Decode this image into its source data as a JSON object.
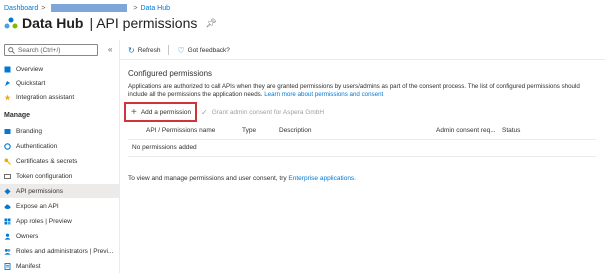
{
  "breadcrumb": {
    "dashboard": "Dashboard",
    "separator": ">",
    "current": "Data Hub"
  },
  "header": {
    "app_title": "Data Hub",
    "page_title": "| API permissions",
    "pin_icon": "pin-icon"
  },
  "sidebar": {
    "search_placeholder": "Search (Ctrl+/)",
    "collapse": "«",
    "top_items": [
      {
        "label": "Overview",
        "icon": "overview-icon"
      },
      {
        "label": "Quickstart",
        "icon": "quickstart-icon"
      },
      {
        "label": "Integration assistant",
        "icon": "integration-assistant-icon"
      }
    ],
    "manage_heading": "Manage",
    "manage_items": [
      {
        "label": "Branding",
        "icon": "branding-icon"
      },
      {
        "label": "Authentication",
        "icon": "authentication-icon"
      },
      {
        "label": "Certificates & secrets",
        "icon": "key-icon"
      },
      {
        "label": "Token configuration",
        "icon": "token-icon"
      },
      {
        "label": "API permissions",
        "icon": "api-permissions-icon"
      },
      {
        "label": "Expose an API",
        "icon": "cloud-icon"
      },
      {
        "label": "App roles | Preview",
        "icon": "app-roles-icon"
      },
      {
        "label": "Owners",
        "icon": "owners-icon"
      },
      {
        "label": "Roles and administrators | Previ...",
        "icon": "roles-icon"
      },
      {
        "label": "Manifest",
        "icon": "manifest-icon"
      }
    ]
  },
  "toolbar": {
    "refresh": "Refresh",
    "feedback": "Got feedback?"
  },
  "main": {
    "section_title": "Configured permissions",
    "description": "Applications are authorized to call APIs when they are granted permissions by users/admins as part of the consent process. The list of configured permissions should include all the permissions the application needs.",
    "description_link": "Learn more about permissions and consent",
    "add_permission": "Add a permission",
    "grant_consent": "Grant admin consent for Aspera GmbH",
    "columns": [
      "API / Permissions name",
      "Type",
      "Description",
      "Admin consent req...",
      "Status"
    ],
    "empty_row": "No permissions added",
    "footer_text": "To view and manage permissions and user consent, try",
    "footer_link": "Enterprise applications."
  },
  "colors": {
    "accent": "#0078d4",
    "highlight_border": "#d13438",
    "selected_bg": "#edebe9"
  }
}
